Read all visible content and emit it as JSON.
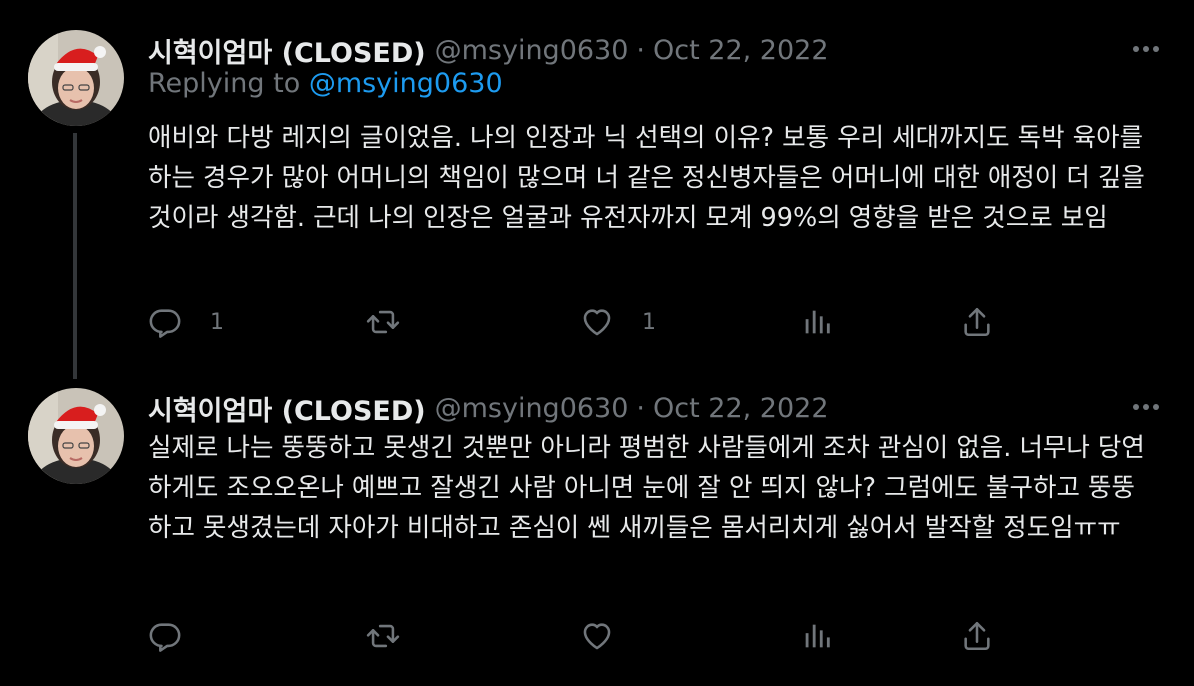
{
  "tweets": [
    {
      "author_name": "시혁이엄마 (CLOSED)",
      "handle": "@msying0630",
      "separator": "·",
      "date": "Oct 22, 2022",
      "replying_prefix": "Replying to",
      "replying_to": "@msying0630",
      "text": "애비와 다방 레지의 글이었음. 나의 인장과 닉 선택의 이유? 보통 우리 세대까지도 독박 육아를 하는 경우가 많아 어머니의 책임이 많으며 너 같은 정신병자들은 어머니에 대한 애정이 더 깊을 것이라 생각함. 근데 나의 인장은 얼굴과 유전자까지 모계 99%의 영향을 받은 것으로 보임",
      "reply_count": "1",
      "retweet_count": "",
      "like_count": "1"
    },
    {
      "author_name": "시혁이엄마 (CLOSED)",
      "handle": "@msying0630",
      "separator": "·",
      "date": "Oct 22, 2022",
      "text": "실제로 나는 뚱뚱하고 못생긴 것뿐만 아니라 평범한 사람들에게 조차 관심이 없음. 너무나 당연하게도 조오오온나 예쁘고 잘생긴 사람 아니면 눈에 잘 안 띄지 않나? 그럼에도 불구하고 뚱뚱하고 못생겼는데 자아가 비대하고 존심이 쎈 새끼들은 몸서리치게 싫어서 발작할 정도임ㅠㅠ",
      "reply_count": "",
      "retweet_count": "",
      "like_count": ""
    }
  ],
  "icons": {
    "more": "more-horizontal-icon",
    "reply": "reply-icon",
    "retweet": "retweet-icon",
    "like": "heart-icon",
    "views": "views-icon",
    "share": "share-icon"
  },
  "colors": {
    "background": "#000000",
    "primary_text": "#e7e9ea",
    "secondary_text": "#71767b",
    "accent": "#1d9bf0",
    "thread_line": "#333639"
  }
}
